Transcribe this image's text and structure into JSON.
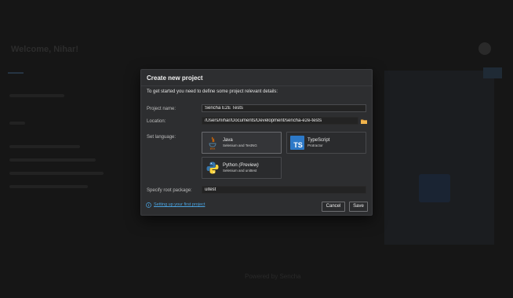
{
  "background": {
    "window_title": "Welcome, Nihar!",
    "footer": "Powered by Sencha"
  },
  "modal": {
    "title": "Create new project",
    "subtitle": "To get started you need to define some project relevant details:",
    "project_name": {
      "label": "Project name:",
      "value": "Sencha E2E Tests"
    },
    "location": {
      "label": "Location:",
      "value": "/Users/nihar/Documents/Development/sencha-e2e-tests",
      "icon": "folder-icon"
    },
    "set_language_label": "Set language:",
    "languages": [
      {
        "name": "Java",
        "desc": "Selenium and TestNG",
        "icon": "java-icon",
        "selected": true
      },
      {
        "name": "TypeScript",
        "desc": "Protractor",
        "icon": "typescript-icon",
        "icon_text": "TS",
        "selected": false
      },
      {
        "name": "Python",
        "name_suffix": "(Preview)",
        "desc": "Selenium and unittest",
        "icon": "python-icon",
        "selected": false
      }
    ],
    "root_package": {
      "label": "Specify root package:",
      "value": "uitest"
    },
    "help_link": "Setting up your first project",
    "buttons": {
      "cancel": "Cancel",
      "save": "Save"
    },
    "colors": {
      "accent_link": "#4aa3e0",
      "typescript": "#2d79c7",
      "folder": "#e8a33d"
    }
  }
}
